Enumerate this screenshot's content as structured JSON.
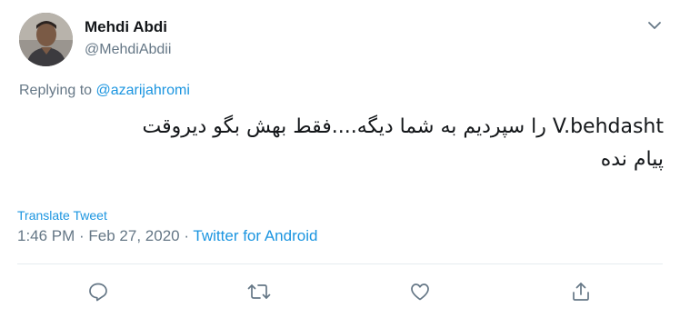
{
  "tweet": {
    "author": {
      "display_name": "Mehdi Abdi",
      "handle": "@MehdiAbdii"
    },
    "replying_prefix": "Replying to ",
    "replying_to": "@azarijahromi",
    "body_line1": "V.behdasht را سپردیم به شما دیگه....فقط بهش بگو دیروقت",
    "body_line2": "پیام نده",
    "translate_label": "Translate Tweet",
    "timestamp": "1:46 PM · Feb 27, 2020",
    "separator": " · ",
    "source": "Twitter for Android"
  },
  "actions": [
    {
      "name": "reply",
      "icon": "reply-icon"
    },
    {
      "name": "retweet",
      "icon": "retweet-icon"
    },
    {
      "name": "like",
      "icon": "heart-icon"
    },
    {
      "name": "share",
      "icon": "share-icon"
    }
  ],
  "colors": {
    "link": "#1b95e0",
    "secondary_text": "#657786",
    "primary_text": "#14171a",
    "divider": "#e6ecf0"
  }
}
